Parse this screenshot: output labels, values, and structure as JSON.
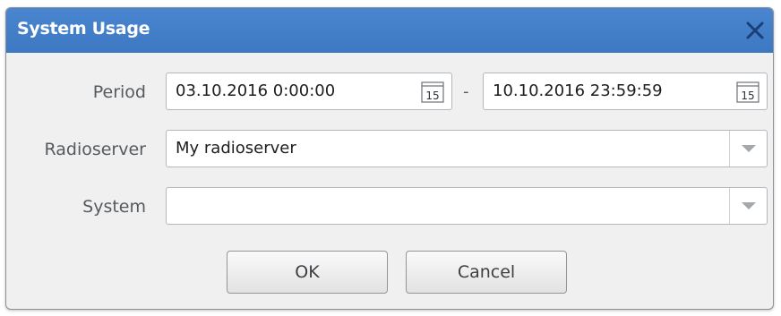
{
  "dialog": {
    "title": "System Usage",
    "close_icon": "close-icon"
  },
  "period": {
    "label": "Period",
    "from": "03.10.2016 0:00:00",
    "separator": "-",
    "to": "10.10.2016 23:59:59",
    "calendar_icon_text": "15"
  },
  "radioserver": {
    "label": "Radioserver",
    "value": "My radioserver"
  },
  "system": {
    "label": "System",
    "value": ""
  },
  "buttons": {
    "ok": "OK",
    "cancel": "Cancel"
  },
  "colors": {
    "titlebar": "#3d78c2",
    "close_icon": "#5a8ed4",
    "background": "#f0f0f0"
  }
}
